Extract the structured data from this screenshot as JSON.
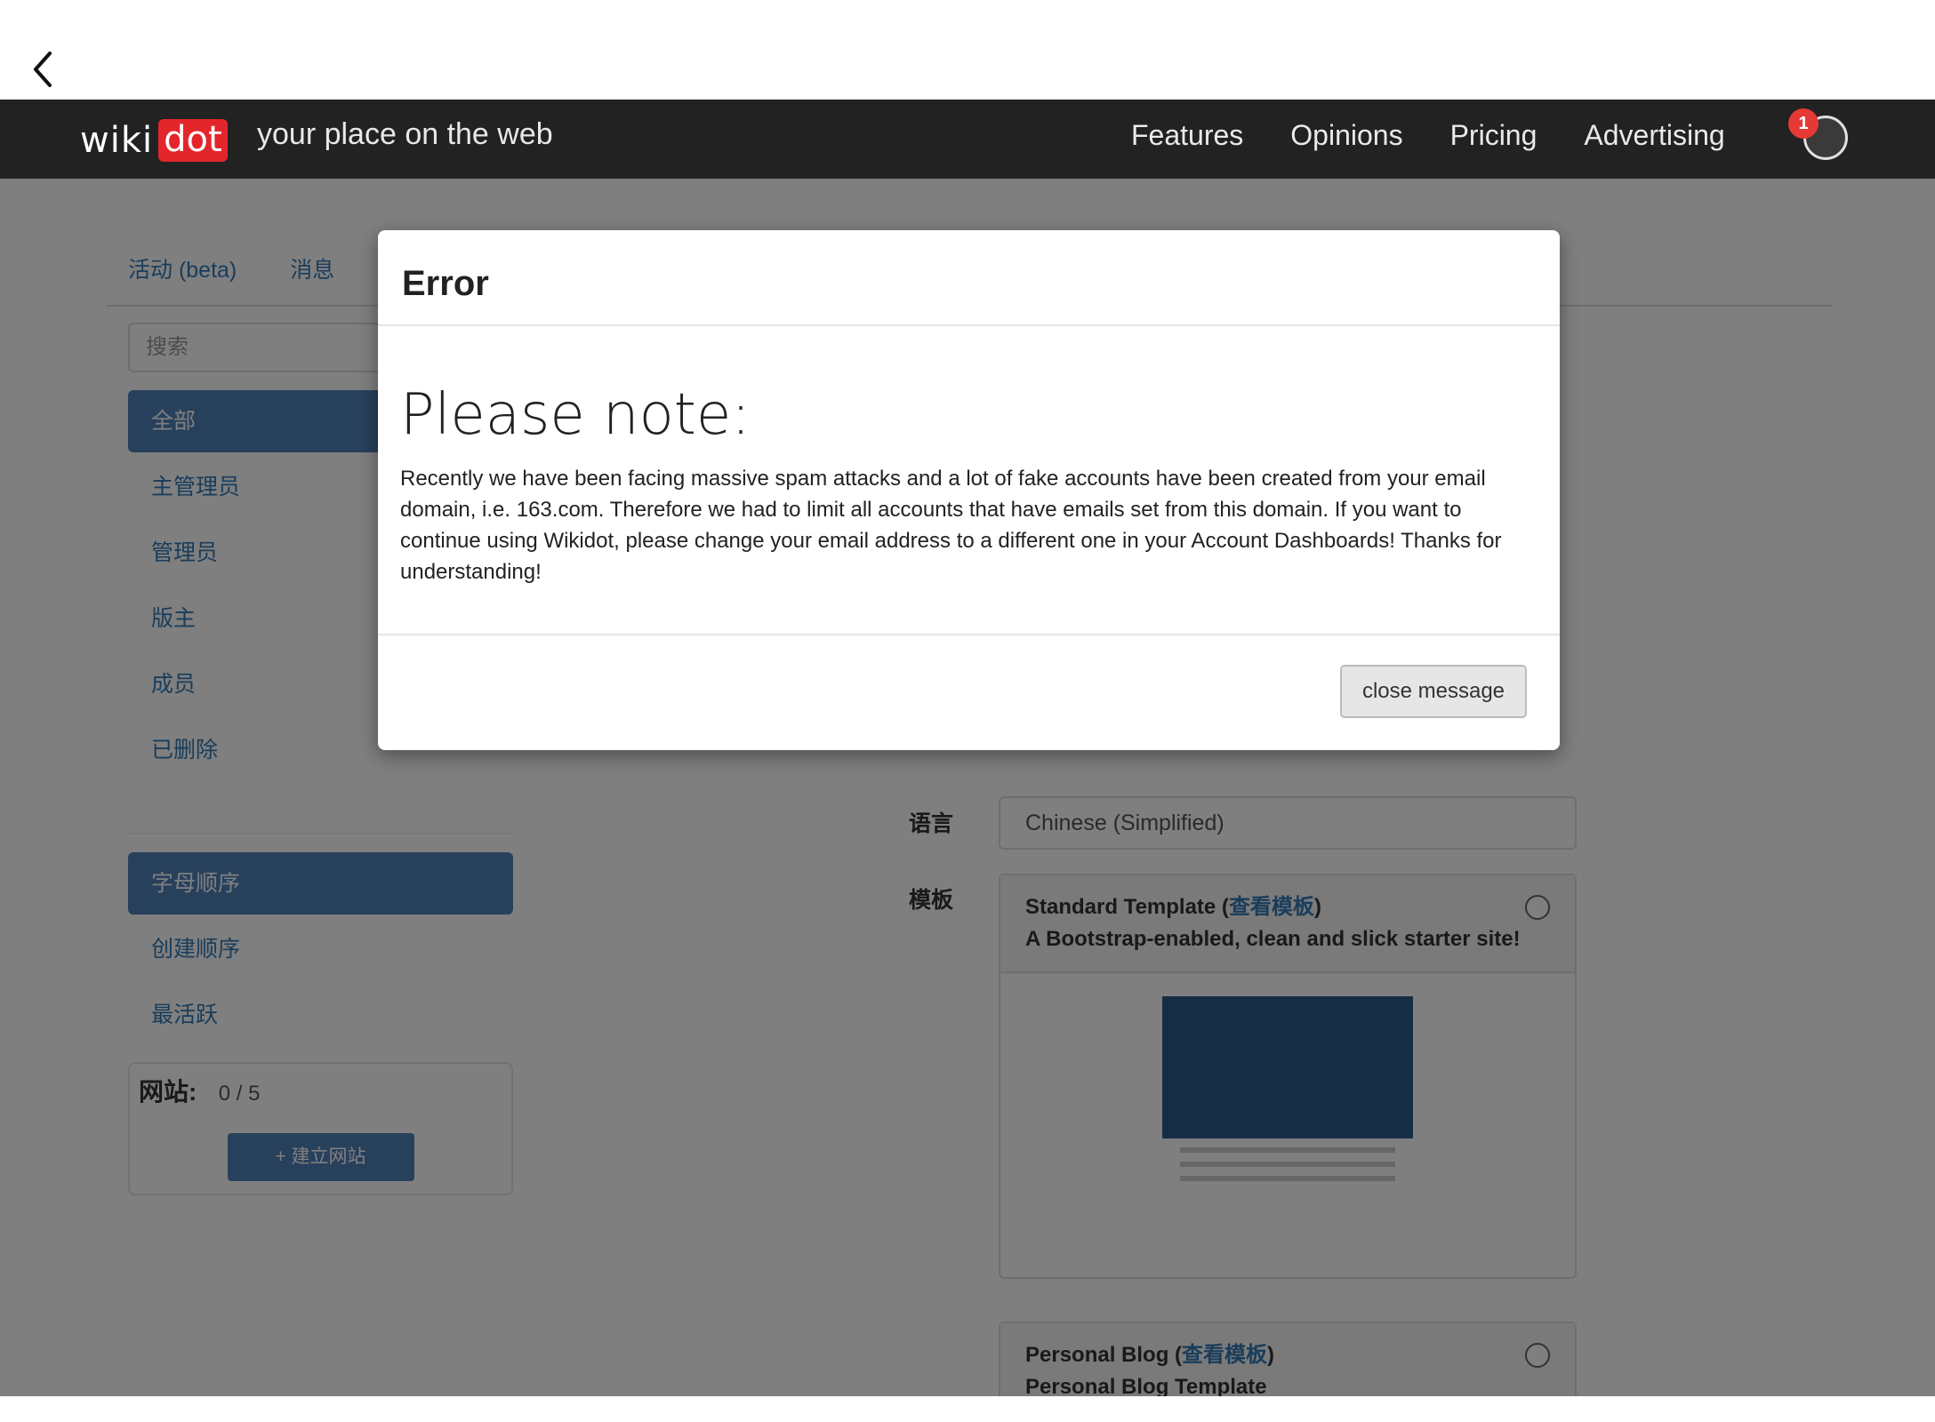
{
  "nav": {
    "logo_wiki": "wiki",
    "logo_dot": "dot",
    "tagline": "your place on the web",
    "links": [
      "Features",
      "Opinions",
      "Pricing",
      "Advertising"
    ],
    "notification_count": "1"
  },
  "tabs": [
    "活动 (beta)",
    "消息"
  ],
  "sidebar": {
    "search_placeholder": "搜索",
    "filters": [
      "全部",
      "主管理员",
      "管理员",
      "版主",
      "成员",
      "已删除"
    ],
    "sorts": [
      "字母顺序",
      "创建顺序",
      "最活跃"
    ],
    "sites_label": "网站:",
    "sites_count": "0 / 5",
    "create_label": "+ 建立网站"
  },
  "form": {
    "language_label": "语言",
    "language_value": "Chinese (Simplified)",
    "template_label": "模板",
    "templates": [
      {
        "name": "Standard Template",
        "link": "查看模板",
        "desc": "A Bootstrap-enabled, clean and slick starter site!"
      },
      {
        "name": "Personal Blog",
        "link": "查看模板",
        "desc": "Personal Blog Template"
      }
    ]
  },
  "modal": {
    "title": "Error",
    "heading": "Please note:",
    "message": "Recently we have been facing massive spam attacks and a lot of fake accounts have been created from your email domain, i.e. 163.com. Therefore we had to limit all accounts that have emails set from this domain. If you want to continue using Wikidot, please change your email address to a different one in your Account Dashboards! Thanks for understanding!",
    "close_label": "close message"
  }
}
